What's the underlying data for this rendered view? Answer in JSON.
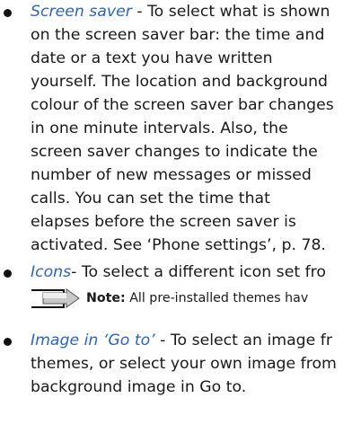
{
  "items": [
    {
      "link": "Screen saver",
      "lines": [
        " - To select what is shown",
        "on the screen saver bar: the time and",
        "date or a text you have written",
        "yourself. The location and background",
        "colour of the screen saver bar changes",
        "in one minute intervals. Also, the",
        "screen saver changes to indicate the",
        "number of new messages or missed",
        "calls. You can set the time that",
        "elapses before the screen saver is",
        "activated. See ‘Phone settings’, p. 78."
      ]
    },
    {
      "link": "Icons",
      "lines": [
        "- To select a different icon set fro"
      ]
    },
    {
      "link": "Image in ‘Go to’",
      "lines": [
        " - To select an image fr",
        "themes, or select your own image from",
        "background image in Go to."
      ]
    }
  ],
  "note": {
    "label": "Note:",
    "text": " All pre-installed themes hav"
  }
}
